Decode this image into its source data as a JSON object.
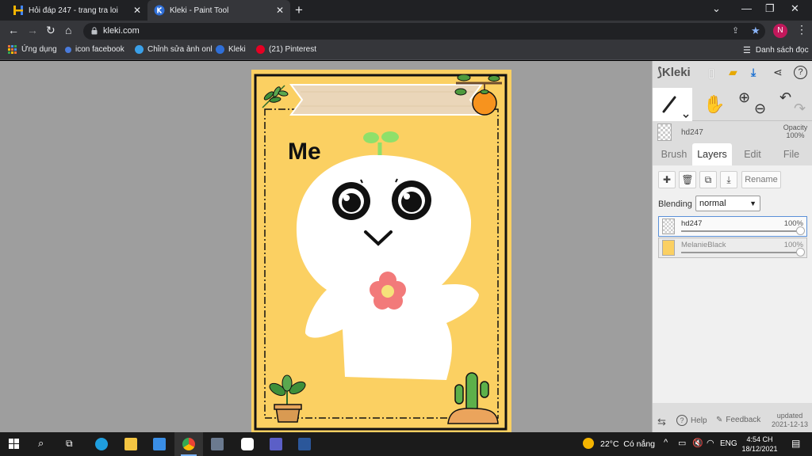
{
  "browser": {
    "tabs": [
      {
        "title": "Hỏi đáp 247 - trang tra loi",
        "active": false
      },
      {
        "title": "Kleki - Paint Tool",
        "active": true
      }
    ],
    "url": "kleki.com",
    "profile_initial": "N",
    "reading_list": "Danh sách đọc",
    "bookmarks": [
      {
        "label": "Ứng dụng",
        "icon": "apps-grid-icon",
        "color": "#e8713c"
      },
      {
        "label": "icon facebook",
        "icon": "dot-icon",
        "color": "#4a7bdc"
      },
      {
        "label": "Chỉnh sửa ảnh onl",
        "icon": "photo-editor-icon",
        "color": "#3aa0e8"
      },
      {
        "label": "Kleki",
        "icon": "kleki-icon",
        "color": "#2f6fd8"
      },
      {
        "label": "(21) Pinterest",
        "icon": "pinterest-icon",
        "color": "#e60023"
      }
    ]
  },
  "canvas": {
    "caption": "Me",
    "paper_color": "#fbd062"
  },
  "panel": {
    "logo": "Kleki",
    "layer_name": "hd247",
    "opacity_label": "Opacity",
    "opacity_value": "100%",
    "tabs": [
      "Brush",
      "Layers",
      "Edit",
      "File"
    ],
    "active_tab": "Layers",
    "rename_label": "Rename",
    "blending_label": "Blending",
    "blending_value": "normal",
    "layers": [
      {
        "name": "hd247",
        "opacity": "100%",
        "selected": true
      },
      {
        "name": "MelanieBlack",
        "opacity": "100%",
        "selected": false
      }
    ],
    "footer": {
      "help": "Help",
      "feedback": "Feedback",
      "updated_label": "updated",
      "updated_date": "2021-12-13"
    }
  },
  "taskbar": {
    "weather": "22°C  Có nắng",
    "language": "ENG",
    "time": "4:54 CH",
    "date": "18/12/2021"
  }
}
